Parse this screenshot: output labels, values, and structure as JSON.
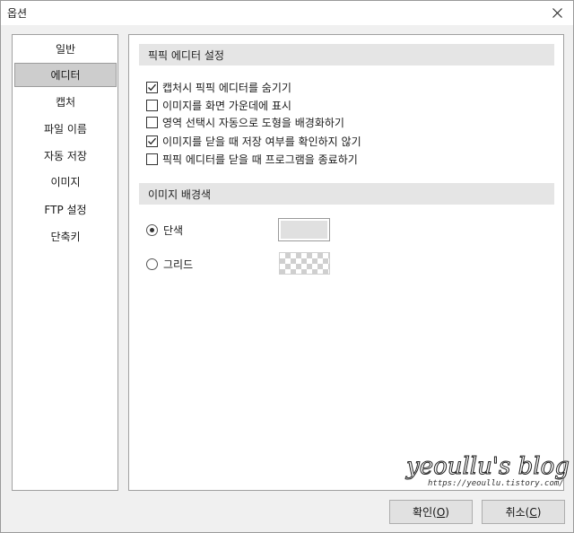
{
  "window": {
    "title": "옵션",
    "close_label": "×"
  },
  "sidebar": {
    "items": [
      {
        "label": "일반",
        "selected": false
      },
      {
        "label": "에디터",
        "selected": true
      },
      {
        "label": "캡처",
        "selected": false
      },
      {
        "label": "파일 이름",
        "selected": false
      },
      {
        "label": "자동 저장",
        "selected": false
      },
      {
        "label": "이미지",
        "selected": false
      },
      {
        "label": "FTP 설정",
        "selected": false
      },
      {
        "label": "단축키",
        "selected": false
      }
    ]
  },
  "editor_settings": {
    "header": "픽픽 에디터 설정",
    "options": [
      {
        "label": "캡처시 픽픽 에디터를 숨기기",
        "checked": true
      },
      {
        "label": "이미지를 화면 가운데에 표시",
        "checked": false
      },
      {
        "label": "영역 선택시 자동으로 도형을 배경화하기",
        "checked": false
      },
      {
        "label": "이미지를 닫을 때 저장 여부를 확인하지 않기",
        "checked": true
      },
      {
        "label": "픽픽 에디터를 닫을 때 프로그램을 종료하기",
        "checked": false
      }
    ]
  },
  "background": {
    "header": "이미지 배경색",
    "options": [
      {
        "label": "단색",
        "selected": true
      },
      {
        "label": "그리드",
        "selected": false
      }
    ],
    "solid_color": "#e0e0e0"
  },
  "watermark": {
    "title": "yeoullu's blog",
    "url": "https://yeoullu.tistory.com/"
  },
  "buttons": {
    "ok": {
      "label": "확인",
      "mnemonic": "O"
    },
    "cancel": {
      "label": "취소",
      "mnemonic": "C"
    }
  }
}
